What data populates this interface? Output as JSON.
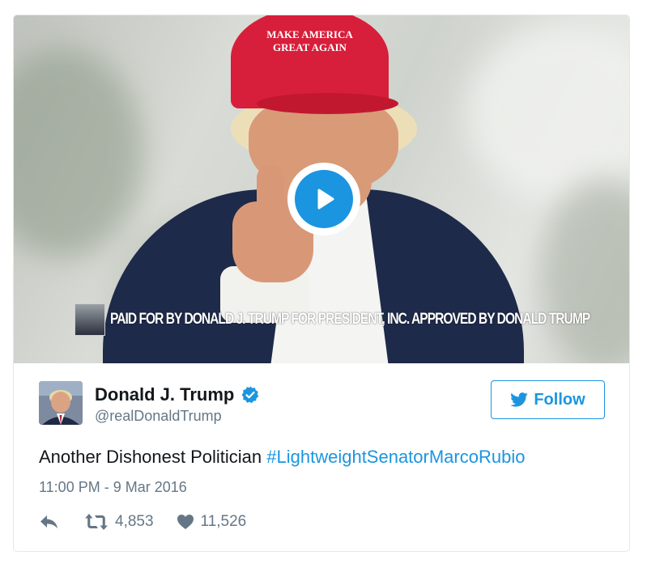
{
  "video": {
    "hat_text_line1": "MAKE AMERICA",
    "hat_text_line2": "GREAT AGAIN",
    "disclaimer": "PAID FOR BY DONALD J. TRUMP FOR PRESIDENT, INC. APPROVED BY DONALD TRUMP"
  },
  "author": {
    "name": "Donald J. Trump",
    "handle": "@realDonaldTrump",
    "verified": true
  },
  "follow_button": {
    "label": "Follow"
  },
  "tweet": {
    "text": "Another Dishonest Politician ",
    "hashtag": "#LightweightSenatorMarcoRubio",
    "timestamp": "11:00 PM - 9 Mar 2016"
  },
  "actions": {
    "retweets": "4,853",
    "likes": "11,526"
  },
  "colors": {
    "accent": "#1b95e0",
    "secondary_text": "#657786",
    "border": "#e1e8ed"
  },
  "icons": [
    "play-icon",
    "verified-icon",
    "twitter-bird-icon",
    "reply-icon",
    "retweet-icon",
    "heart-icon"
  ]
}
